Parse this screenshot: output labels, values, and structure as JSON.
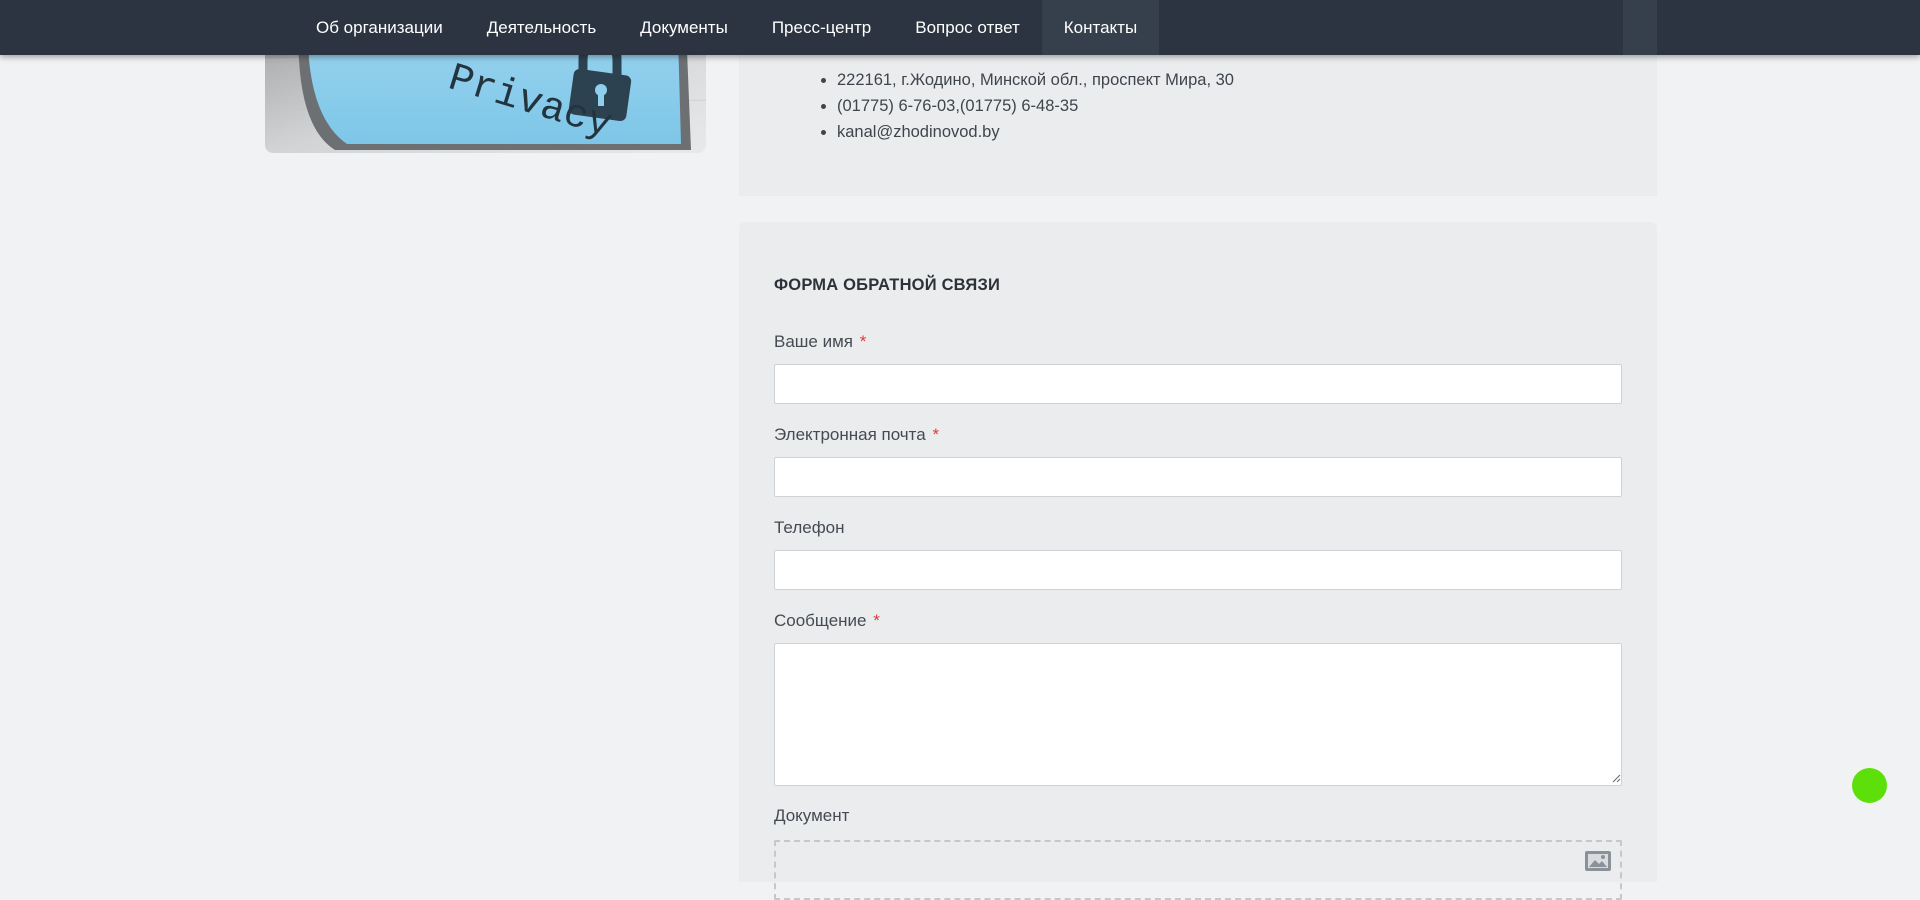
{
  "nav": {
    "items": [
      {
        "label": "Об организации"
      },
      {
        "label": "Деятельность"
      },
      {
        "label": "Документы"
      },
      {
        "label": "Пресс-центр"
      },
      {
        "label": "Вопрос ответ"
      },
      {
        "label": "Контакты",
        "active": true
      }
    ]
  },
  "privacy_image": {
    "text": "Privacy",
    "icon": "padlock-icon"
  },
  "contacts": {
    "address": "222161, г.Жодино, Минской обл., проспект Мира, 30",
    "phones": "(01775) 6-76-03,(01775) 6-48-35",
    "email": "kanal@zhodinovod.by"
  },
  "form": {
    "title": "ФОРМА ОБРАТНОЙ СВЯЗИ",
    "required_mark": "*",
    "name_label": "Ваше имя",
    "name_value": "",
    "email_label": "Электронная почта",
    "email_value": "",
    "phone_label": "Телефон",
    "phone_value": "",
    "message_label": "Сообщение",
    "message_value": "",
    "document_label": "Документ"
  },
  "colors": {
    "nav_bg": "#2b3440",
    "page_bg": "#f1f2f4",
    "panel_bg": "#ebecee",
    "required": "#e03a3a",
    "float_button": "#5de00a"
  }
}
